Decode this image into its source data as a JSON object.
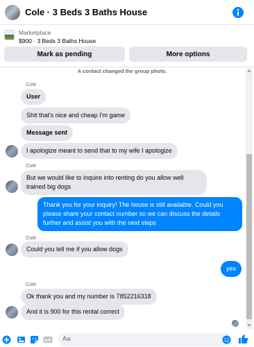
{
  "header": {
    "title": "Cole · 3 Beds 3 Baths House"
  },
  "marketplace": {
    "label": "Marketplace",
    "listing": "$900 · 3 Beds 3 Baths House",
    "mark_pending_label": "Mark as pending",
    "more_options_label": "More options"
  },
  "thread": {
    "system_note": "A contact changed the group photo.",
    "sender_1": "Cole",
    "msg_1": "User",
    "msg_2": "Shit that's nice and cheap I'm game",
    "msg_3": "Message sent",
    "msg_4": "I apologize meant to send that to my wife I apologize",
    "sender_2": "Cole",
    "msg_5": "But we would like to inquire into renting do you allow well trained big dogs",
    "msg_6": "Thank you for your inquiry! The house is still available. Could you please share your contact number so we can discuss the details further and assist you with the next steps",
    "sender_3": "Cole",
    "msg_7": "Could you tell me if you allow dogs",
    "msg_8": "yes",
    "sender_4": "Cole",
    "msg_9": "Ok thank you and my number is 7852216318",
    "msg_10": "And it is 900 for this rental correct"
  },
  "composer": {
    "placeholder": "Aa"
  },
  "colors": {
    "accent": "#0084ff",
    "bubble_in": "#e4e6eb",
    "meta_text": "#65676b"
  },
  "icons": [
    "info-icon",
    "add-icon",
    "photo-icon",
    "sticker-icon",
    "gif-icon",
    "emoji-icon",
    "like-icon"
  ]
}
